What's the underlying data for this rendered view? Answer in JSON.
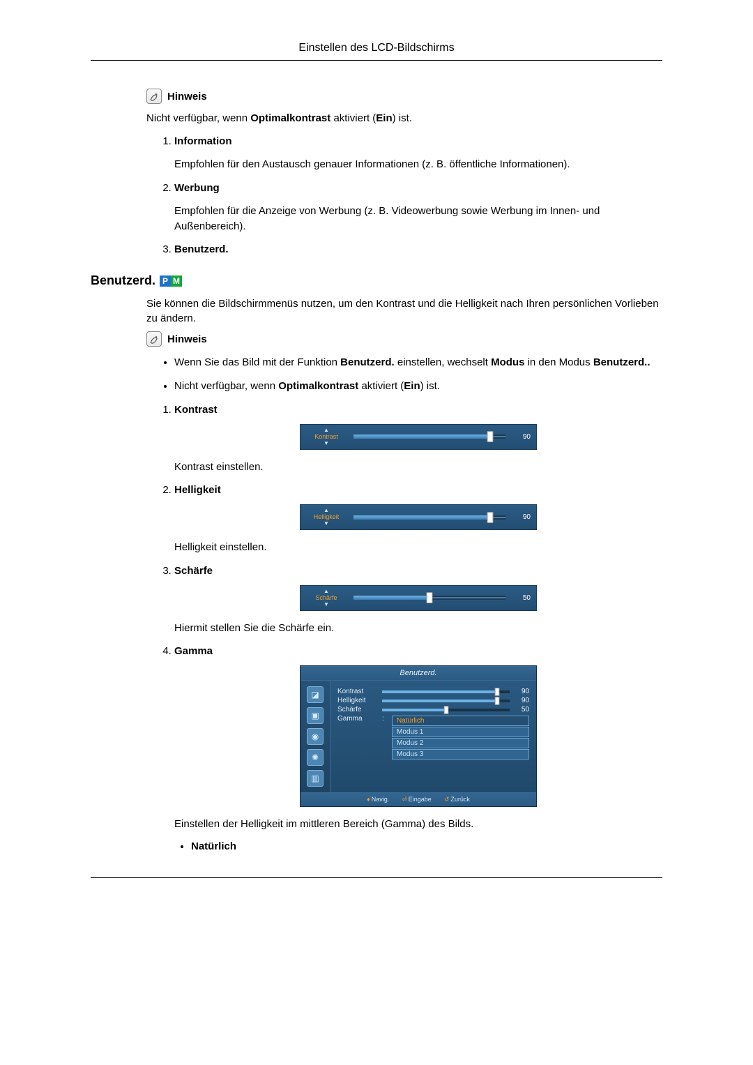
{
  "header": {
    "title": "Einstellen des LCD-Bildschirms"
  },
  "hinweis_label": "Hinweis",
  "intro_note": {
    "pre": "Nicht verfügbar, wenn ",
    "b1": "Optimalkontrast",
    "mid": " aktiviert (",
    "b2": "Ein",
    "post": ") ist."
  },
  "mode_list": [
    {
      "title": "Information",
      "body": "Empfohlen für den Austausch genauer Informationen (z. B. öffentliche Informationen)."
    },
    {
      "title": "Werbung",
      "body": "Empfohlen für die Anzeige von Werbung (z. B. Videowerbung sowie Werbung im Innen- und Außenbereich)."
    },
    {
      "title": "Benutzerd."
    }
  ],
  "section_custom": {
    "title": "Benutzerd.",
    "desc": "Sie können die Bildschirmmenüs nutzen, um den Kontrast und die Helligkeit nach Ihren persönlichen Vorlieben zu ändern.",
    "note_items": [
      {
        "pre": "Wenn Sie das Bild mit der Funktion ",
        "b1": "Benutzerd.",
        "mid": " einstellen, wechselt ",
        "b2": "Modus",
        "mid2": " in den Modus ",
        "b3": "Benutzerd.."
      },
      {
        "pre": "Nicht verfügbar, wenn ",
        "b1": "Optimalkontrast",
        "mid": " aktiviert (",
        "b2": "Ein",
        "post": ") ist."
      }
    ],
    "items": [
      {
        "title": "Kontrast",
        "caption": "Kontrast einstellen.",
        "osd_label": "Kontrast",
        "value": 90,
        "fill_pct": 90,
        "handle_pct": 90
      },
      {
        "title": "Helligkeit",
        "caption": "Helligkeit einstellen.",
        "osd_label": "Helligkeit",
        "value": 90,
        "fill_pct": 90,
        "handle_pct": 90
      },
      {
        "title": "Schärfe",
        "caption": "Hiermit stellen Sie die Schärfe ein.",
        "osd_label": "Schärfe",
        "value": 50,
        "fill_pct": 50,
        "handle_pct": 50
      },
      {
        "title": "Gamma",
        "caption": "Einstellen der Helligkeit im mittleren Bereich (Gamma) des Bilds.",
        "sub_bullets": [
          "Natürlich"
        ]
      }
    ]
  },
  "gamma_panel": {
    "title": "Benutzerd.",
    "rows": [
      {
        "label": "Kontrast",
        "value": 90,
        "fill_pct": 90
      },
      {
        "label": "Helligkeit",
        "value": 90,
        "fill_pct": 90
      },
      {
        "label": "Schärfe",
        "value": 50,
        "fill_pct": 50
      }
    ],
    "gamma_label": "Gamma",
    "gamma_colon": ":",
    "options": [
      {
        "label": "Natürlich",
        "selected": true
      },
      {
        "label": "Modus 1"
      },
      {
        "label": "Modus 2"
      },
      {
        "label": "Modus 3"
      }
    ],
    "footer": {
      "nav": "Navig.",
      "enter": "Eingabe",
      "back": "Zurück"
    }
  },
  "chart_data": {
    "type": "table",
    "title": "OSD slider values",
    "series": [
      {
        "name": "Kontrast",
        "value": 90,
        "range": [
          0,
          100
        ]
      },
      {
        "name": "Helligkeit",
        "value": 90,
        "range": [
          0,
          100
        ]
      },
      {
        "name": "Schärfe",
        "value": 50,
        "range": [
          0,
          100
        ]
      }
    ],
    "gamma_options": [
      "Natürlich",
      "Modus 1",
      "Modus 2",
      "Modus 3"
    ],
    "gamma_selected": "Natürlich"
  }
}
